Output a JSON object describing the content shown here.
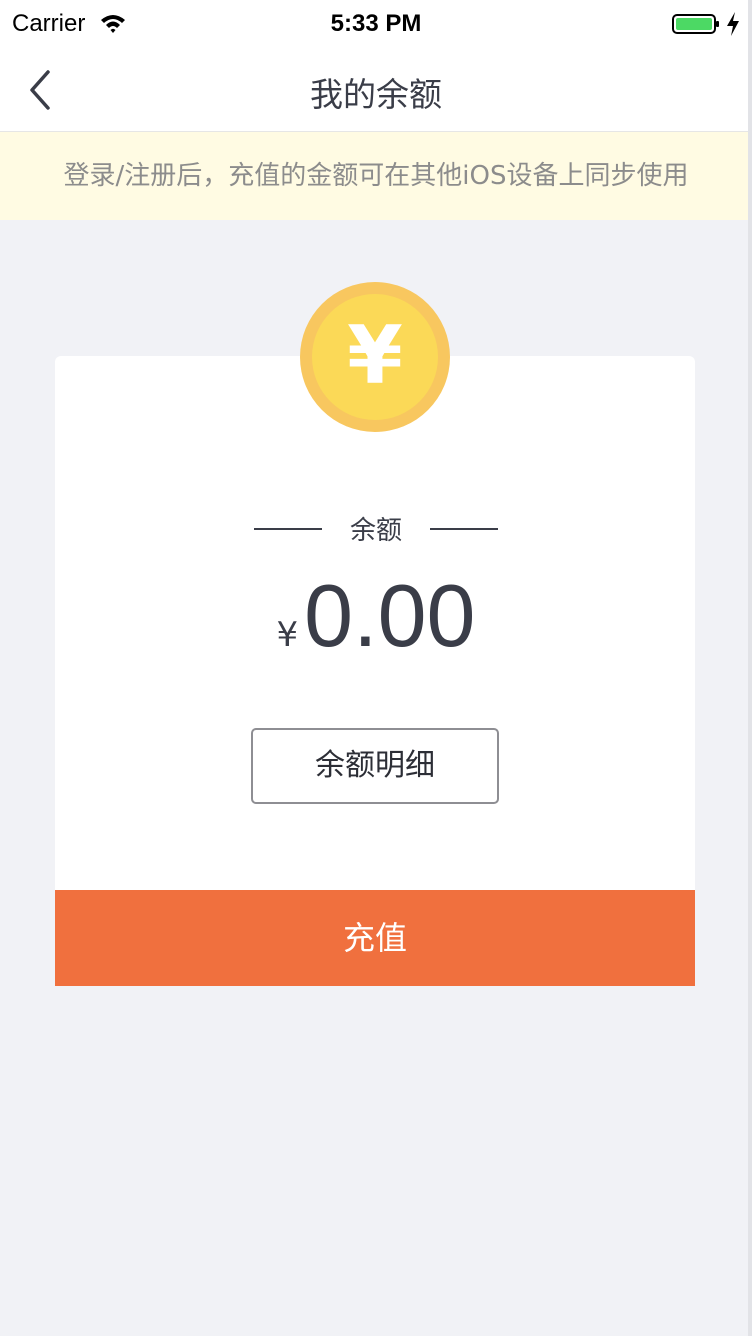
{
  "status_bar": {
    "carrier": "Carrier",
    "time": "5:33 PM",
    "wifi_icon": "wifi-icon",
    "battery_icon": "battery-icon",
    "charging_icon": "charging-bolt-icon"
  },
  "nav": {
    "title": "我的余额",
    "back_icon": "chevron-left-icon"
  },
  "notice": {
    "text": "登录/注册后，充值的金额可在其他iOS设备上同步使用"
  },
  "balance": {
    "coin_symbol": "¥",
    "coin_icon": "yen-coin-icon",
    "label": "余额",
    "currency": "¥",
    "amount": "0.00"
  },
  "buttons": {
    "detail_label": "余额明细",
    "recharge_label": "充值"
  },
  "colors": {
    "accent": "#f0703e",
    "notice_bg": "#fffbe3",
    "coin_outer": "#f8c75f",
    "coin_inner": "#fbd957",
    "text_dark": "#3a3d48",
    "page_bg": "#f1f2f6"
  }
}
